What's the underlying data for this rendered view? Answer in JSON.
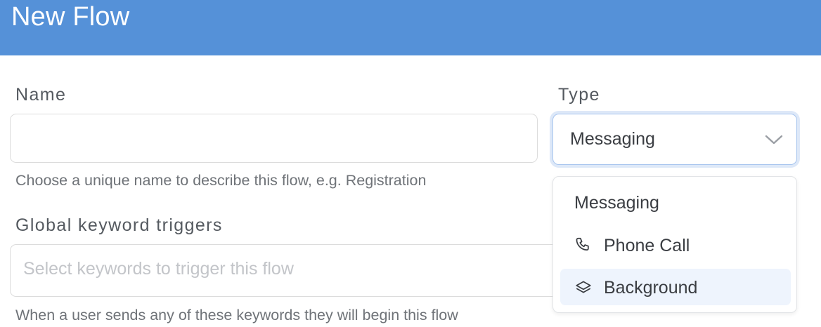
{
  "header": {
    "title": "New Flow"
  },
  "name_field": {
    "label": "Name",
    "value": "",
    "help": "Choose a unique name to describe this flow, e.g. Registration"
  },
  "keywords_field": {
    "label": "Global keyword triggers",
    "placeholder": "Select keywords to trigger this flow",
    "help": "When a user sends any of these keywords they will begin this flow"
  },
  "type_field": {
    "label": "Type",
    "selected": "Messaging",
    "options": [
      {
        "label": "Messaging",
        "icon": ""
      },
      {
        "label": "Phone Call",
        "icon": "phone-icon"
      },
      {
        "label": "Background",
        "icon": "layers-icon"
      }
    ],
    "highlighted_option": "Background"
  },
  "colors": {
    "header_bg": "#5591d8",
    "focus_ring": "#a9c6ef",
    "option_highlight": "#eef4fd"
  }
}
